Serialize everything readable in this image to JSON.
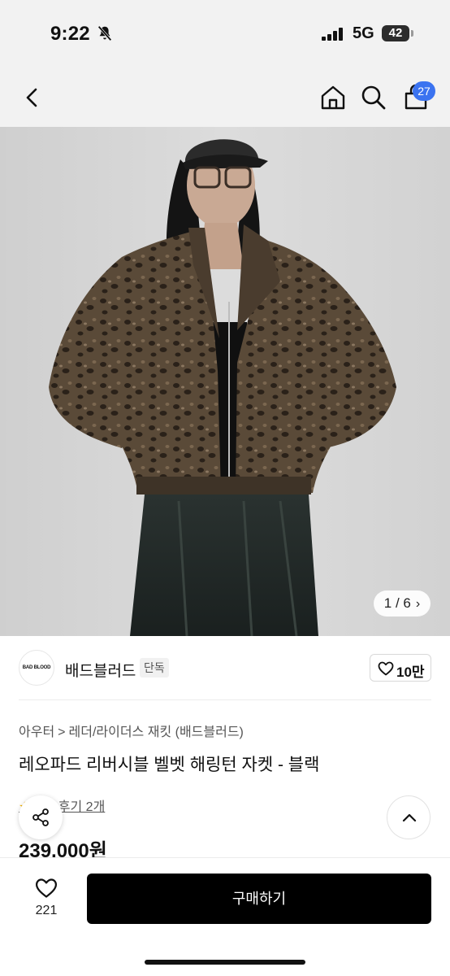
{
  "status_bar": {
    "time": "9:22",
    "network": "5G",
    "battery": "42"
  },
  "nav": {
    "cart_count": "27"
  },
  "gallery": {
    "counter": "1 / 6",
    "next_glyph": "›"
  },
  "store": {
    "logo_text": "BAD BLOOD",
    "name": "배드블러드",
    "badge": "단독",
    "like_count": "10만"
  },
  "product": {
    "breadcrumb": [
      "아우터",
      "레더/라이더스 재킷 (배드블러드)"
    ],
    "breadcrumb_sep": ">",
    "title": "레오파드 리버시블 벨벳 해링턴 자켓 - 블랙",
    "reviews": "후기 2개",
    "price": "239,000원"
  },
  "bottom_bar": {
    "wish_count": "221",
    "buy_label": "구매하기"
  },
  "colors": {
    "accent": "#3b73f0",
    "buy_button": "#000000",
    "header_bg": "#f2f2f2"
  }
}
